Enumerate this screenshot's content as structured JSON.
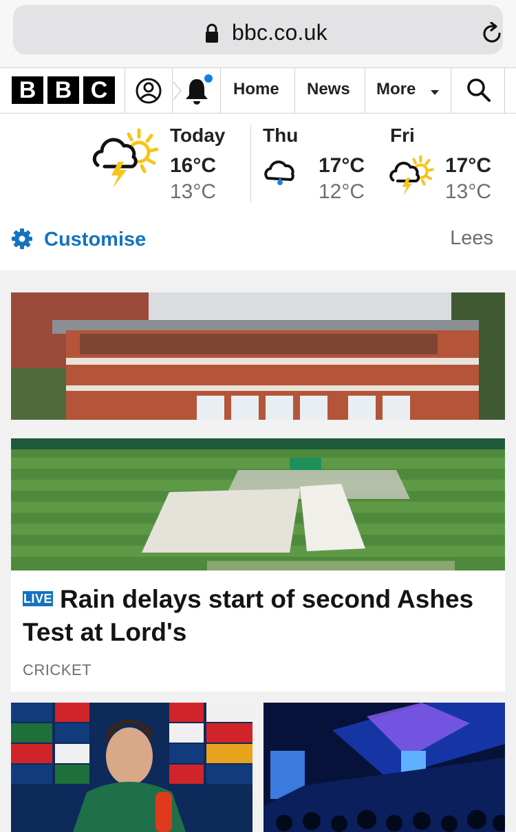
{
  "browser": {
    "url": "bbc.co.uk"
  },
  "nav": {
    "logo_letters": [
      "B",
      "B",
      "C"
    ],
    "links": [
      "Home",
      "News",
      "More"
    ],
    "notification_dot_color": "#1380e0"
  },
  "weather": {
    "days": [
      {
        "name": "Today",
        "high": "16°C",
        "low": "13°C",
        "icon": "thunder-sun-cloud"
      },
      {
        "name": "Thu",
        "high": "17°C",
        "low": "12°C",
        "icon": "rain-cloud"
      },
      {
        "name": "Fri",
        "high": "17°C",
        "low": "13°C",
        "icon": "thunder-sun-cloud"
      }
    ],
    "customise_label": "Customise",
    "location": "Lees"
  },
  "lead_story": {
    "badge": "LIVE",
    "headline": "Rain delays start of second Ashes Test at Lord's",
    "section": "CRICKET",
    "image_desc": "Lord's pavilion with covers on the wet outfield"
  },
  "tiles": [
    {
      "image_desc": "Referee at press conference"
    },
    {
      "image_desc": "Concert stage with blue lights"
    }
  ],
  "colors": {
    "accent": "#1473bf",
    "live": "#1473bf"
  }
}
